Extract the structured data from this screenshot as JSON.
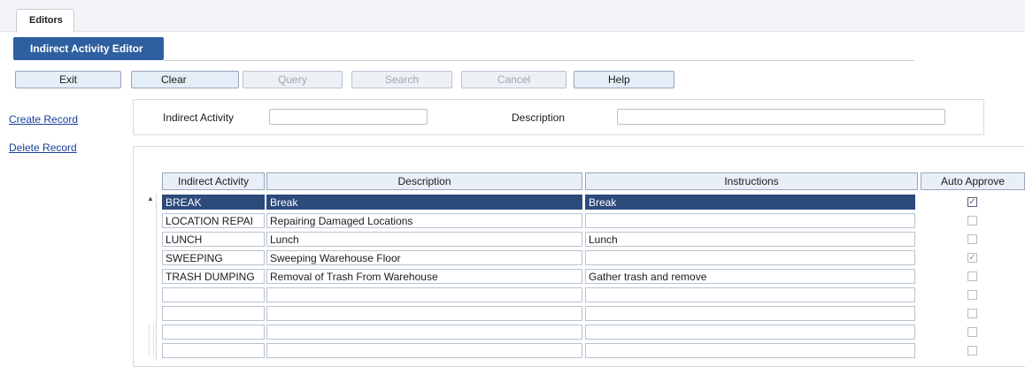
{
  "tabs": {
    "editors": "Editors"
  },
  "title": "Indirect Activity Editor",
  "toolbar": {
    "exit": "Exit",
    "clear": "Clear",
    "query": "Query",
    "search": "Search",
    "cancel": "Cancel",
    "help": "Help"
  },
  "links": {
    "create": "Create Record",
    "delete": "Delete Record"
  },
  "search": {
    "activity_label": "Indirect Activity",
    "description_label": "Description",
    "activity_value": "",
    "description_value": ""
  },
  "table": {
    "headers": [
      "Indirect Activity",
      "Description",
      "Instructions",
      "Auto Approve"
    ],
    "rows": [
      {
        "activity": "BREAK",
        "description": "Break",
        "instructions": "Break",
        "auto_approve": true,
        "selected": true
      },
      {
        "activity": "LOCATION REPAI",
        "description": "Repairing Damaged Locations",
        "instructions": "",
        "auto_approve": false,
        "selected": false
      },
      {
        "activity": "LUNCH",
        "description": "Lunch",
        "instructions": "Lunch",
        "auto_approve": false,
        "selected": false
      },
      {
        "activity": "SWEEPING",
        "description": "Sweeping Warehouse Floor",
        "instructions": "",
        "auto_approve": true,
        "selected": false
      },
      {
        "activity": "TRASH DUMPING",
        "description": "Removal of Trash From Warehouse",
        "instructions": "Gather trash and remove",
        "auto_approve": false,
        "selected": false
      },
      {
        "activity": "",
        "description": "",
        "instructions": "",
        "auto_approve": false,
        "selected": false
      },
      {
        "activity": "",
        "description": "",
        "instructions": "",
        "auto_approve": false,
        "selected": false
      },
      {
        "activity": "",
        "description": "",
        "instructions": "",
        "auto_approve": false,
        "selected": false
      },
      {
        "activity": "",
        "description": "",
        "instructions": "",
        "auto_approve": false,
        "selected": false
      }
    ]
  },
  "icons": {
    "scroll_up": "scroll-up-icon",
    "check": "checkmark-icon"
  },
  "colors": {
    "accent": "#2e5fa0",
    "selected_row": "#2c4a7a",
    "link": "#1a3f9c"
  }
}
